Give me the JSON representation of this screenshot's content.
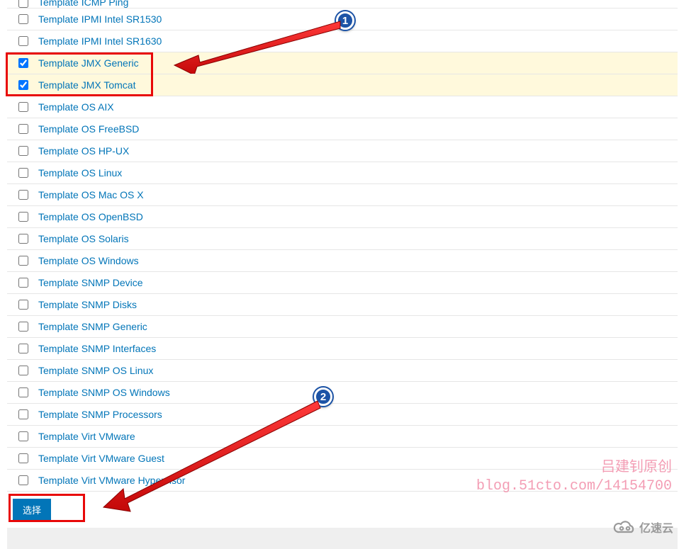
{
  "templates": [
    {
      "label": "Template ICMP Ping",
      "checked": false,
      "partialTop": true
    },
    {
      "label": "Template IPMI Intel SR1530",
      "checked": false
    },
    {
      "label": "Template IPMI Intel SR1630",
      "checked": false
    },
    {
      "label": "Template JMX Generic",
      "checked": true
    },
    {
      "label": "Template JMX Tomcat",
      "checked": true
    },
    {
      "label": "Template OS AIX",
      "checked": false
    },
    {
      "label": "Template OS FreeBSD",
      "checked": false
    },
    {
      "label": "Template OS HP-UX",
      "checked": false
    },
    {
      "label": "Template OS Linux",
      "checked": false
    },
    {
      "label": "Template OS Mac OS X",
      "checked": false
    },
    {
      "label": "Template OS OpenBSD",
      "checked": false
    },
    {
      "label": "Template OS Solaris",
      "checked": false
    },
    {
      "label": "Template OS Windows",
      "checked": false
    },
    {
      "label": "Template SNMP Device",
      "checked": false
    },
    {
      "label": "Template SNMP Disks",
      "checked": false
    },
    {
      "label": "Template SNMP Generic",
      "checked": false
    },
    {
      "label": "Template SNMP Interfaces",
      "checked": false
    },
    {
      "label": "Template SNMP OS Linux",
      "checked": false
    },
    {
      "label": "Template SNMP OS Windows",
      "checked": false
    },
    {
      "label": "Template SNMP Processors",
      "checked": false
    },
    {
      "label": "Template Virt VMware",
      "checked": false
    },
    {
      "label": "Template Virt VMware Guest",
      "checked": false
    },
    {
      "label": "Template Virt VMware Hypervisor",
      "checked": false
    }
  ],
  "footer": {
    "select_label": "选择"
  },
  "callouts": {
    "c1": "1",
    "c2": "2"
  },
  "watermark": {
    "line1": "吕建钊原创",
    "line2": "blog.51cto.com/14154700",
    "brand": "亿速云"
  }
}
